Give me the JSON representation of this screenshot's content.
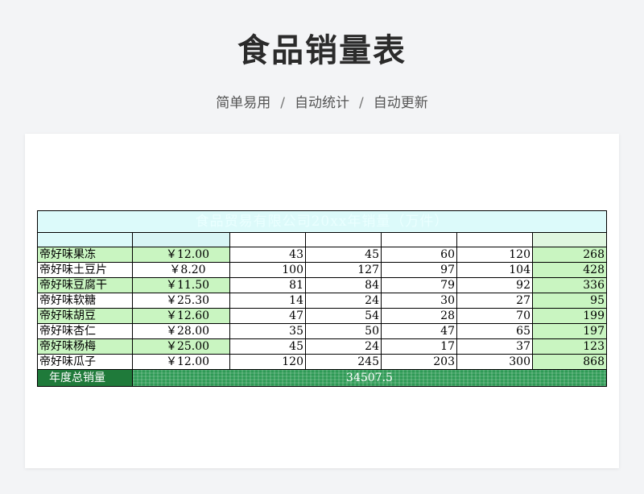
{
  "page": {
    "title": "食品销量表",
    "subtitle": [
      "简单易用",
      "自动统计",
      "自动更新"
    ],
    "separator": "/"
  },
  "sheet": {
    "title": "食品贸易有限公司20xx年销量（万件）",
    "columns": [
      "",
      "",
      "",
      "",
      "",
      "",
      ""
    ],
    "rows": [
      {
        "name": "帝好味果冻",
        "price": "￥12.00",
        "values": [
          "43",
          "45",
          "60",
          "120"
        ],
        "total": "268"
      },
      {
        "name": "帝好味土豆片",
        "price": "￥8.20",
        "values": [
          "100",
          "127",
          "97",
          "104"
        ],
        "total": "428"
      },
      {
        "name": "帝好味豆腐干",
        "price": "￥11.50",
        "values": [
          "81",
          "84",
          "79",
          "92"
        ],
        "total": "336"
      },
      {
        "name": "帝好味软糖",
        "price": "￥25.30",
        "values": [
          "14",
          "24",
          "30",
          "27"
        ],
        "total": "95"
      },
      {
        "name": "帝好味胡豆",
        "price": "￥12.60",
        "values": [
          "47",
          "54",
          "28",
          "70"
        ],
        "total": "199"
      },
      {
        "name": "帝好味杏仁",
        "price": "￥28.00",
        "values": [
          "35",
          "50",
          "47",
          "65"
        ],
        "total": "197"
      },
      {
        "name": "帝好味杨梅",
        "price": "￥25.00",
        "values": [
          "45",
          "24",
          "17",
          "37"
        ],
        "total": "123"
      },
      {
        "name": "帝好味瓜子",
        "price": "￥12.00",
        "values": [
          "120",
          "245",
          "203",
          "300"
        ],
        "total": "868"
      }
    ],
    "annual_label": "年度总销量",
    "annual_value": "34507.5"
  },
  "colors": {
    "green_cell": "#c9f5c1",
    "header_cyan": "#dcfafa",
    "total_green": "#2e9a55"
  }
}
